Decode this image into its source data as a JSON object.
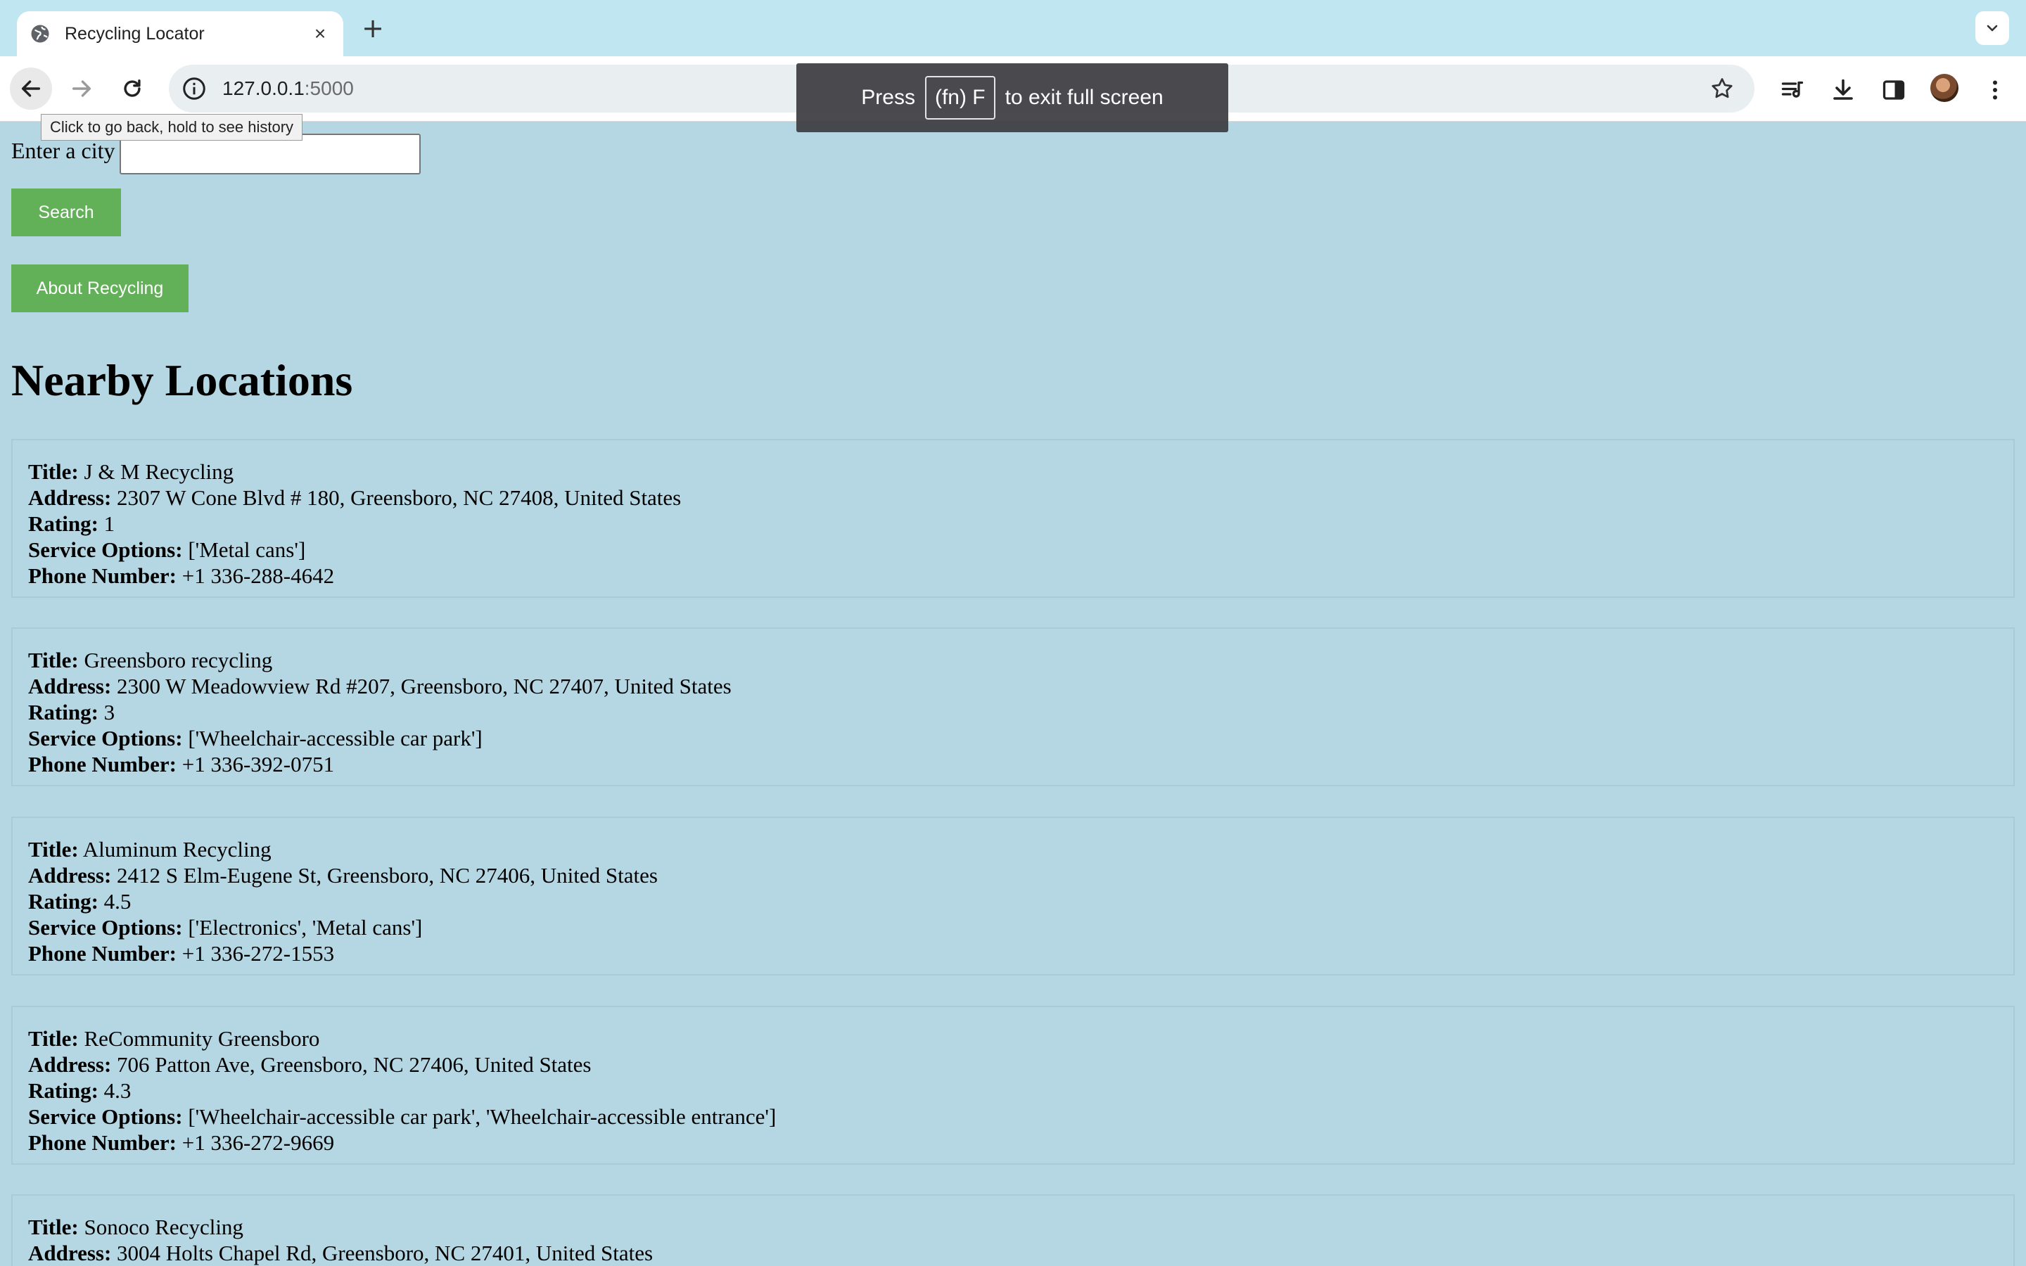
{
  "browser": {
    "tab_title": "Recycling Locator",
    "url_host": "127.0.0.1",
    "url_port": ":5000",
    "back_tooltip": "Click to go back, hold to see history",
    "fullscreen_toast": {
      "press": "Press",
      "key": "(fn) F",
      "suffix": "to exit full screen"
    }
  },
  "search": {
    "label": "Enter a city",
    "value": "",
    "button_label": "Search"
  },
  "about_button_label": "About Recycling",
  "section_title": "Nearby Locations",
  "field_labels": {
    "title": "Title:",
    "address": "Address:",
    "rating": "Rating:",
    "service_options": "Service Options:",
    "phone": "Phone Number:"
  },
  "locations": [
    {
      "title": "J & M Recycling",
      "address": "2307 W Cone Blvd # 180, Greensboro, NC 27408, United States",
      "rating": "1",
      "service_options": "['Metal cans']",
      "phone": "+1 336-288-4642"
    },
    {
      "title": "Greensboro recycling",
      "address": "2300 W Meadowview Rd #207, Greensboro, NC 27407, United States",
      "rating": "3",
      "service_options": "['Wheelchair-accessible car park']",
      "phone": "+1 336-392-0751"
    },
    {
      "title": "Aluminum Recycling",
      "address": "2412 S Elm-Eugene St, Greensboro, NC 27406, United States",
      "rating": "4.5",
      "service_options": "['Electronics', 'Metal cans']",
      "phone": "+1 336-272-1553"
    },
    {
      "title": "ReCommunity Greensboro",
      "address": "706 Patton Ave, Greensboro, NC 27406, United States",
      "rating": "4.3",
      "service_options": "['Wheelchair-accessible car park', 'Wheelchair-accessible entrance']",
      "phone": "+1 336-272-9669"
    },
    {
      "title": "Sonoco Recycling",
      "address": "3004 Holts Chapel Rd, Greensboro, NC 27401, United States"
    }
  ]
}
